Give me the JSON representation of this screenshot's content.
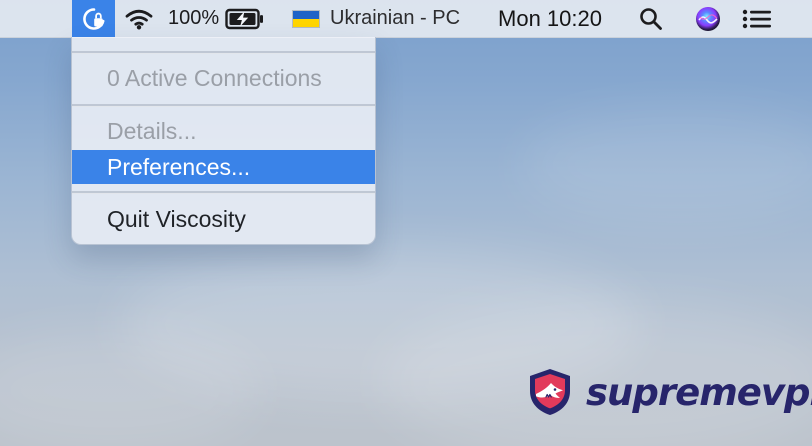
{
  "menu_bar": {
    "battery_text": "100%",
    "input_source": "Ukrainian - PC",
    "clock": "Mon 10:20",
    "icons": {
      "vpn": "lock-icon",
      "wifi": "wifi-icon",
      "battery": "battery-charging-icon",
      "flag": "ukraine-flag-icon",
      "search": "search-icon",
      "siri": "siri-icon",
      "control": "list-icon"
    }
  },
  "viscosity_menu": {
    "items": [
      {
        "label": "0 Active Connections",
        "state": "disabled"
      },
      {
        "label": "Details...",
        "state": "disabled"
      },
      {
        "label": "Preferences...",
        "state": "selected"
      },
      {
        "label": "Quit Viscosity",
        "state": "enabled"
      }
    ]
  },
  "watermark": {
    "brand_text": "supremevpn",
    "icon": "shark-shield-icon"
  },
  "colors": {
    "menu_highlight": "#3a83e8",
    "brand_navy": "#27256b",
    "brand_red": "#e23a5b"
  }
}
